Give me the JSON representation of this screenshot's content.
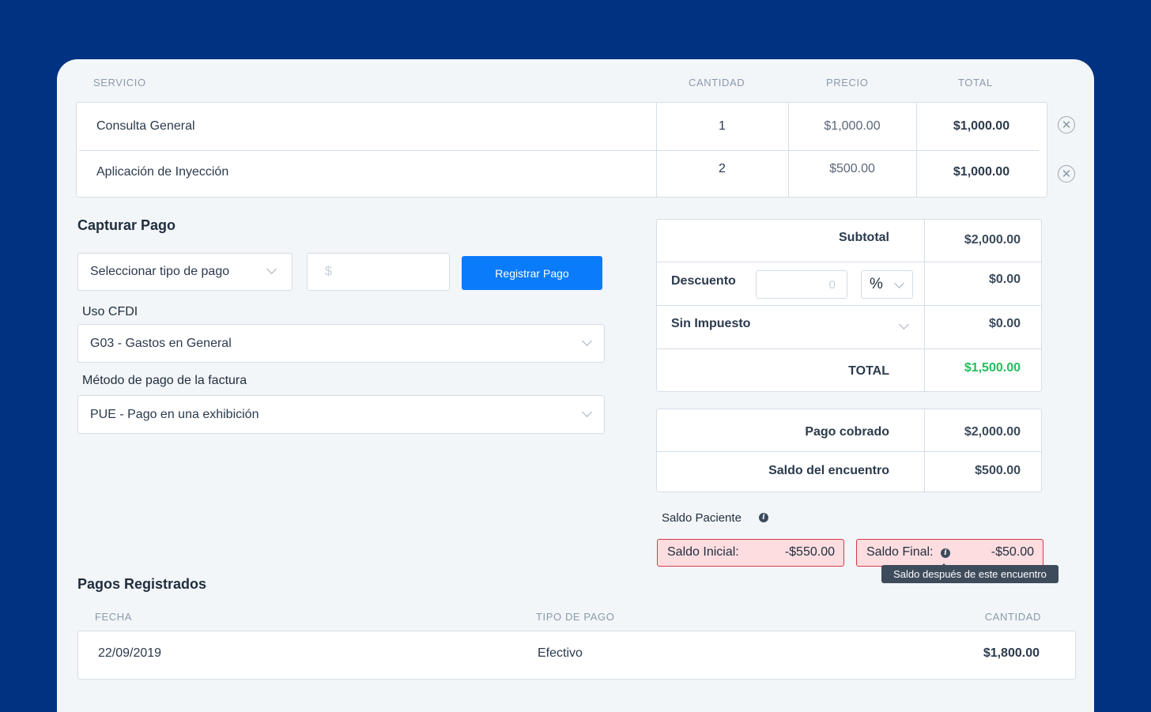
{
  "services": {
    "headers": {
      "service": "SERVICIO",
      "quantity": "CANTIDAD",
      "price": "PRECIO",
      "total": "TOTAL"
    },
    "rows": [
      {
        "service": "Consulta General",
        "quantity": "1",
        "price": "$1,000.00",
        "total": "$1,000.00"
      },
      {
        "service": "Aplicación de Inyección",
        "quantity": "2",
        "price": "$500.00",
        "total": "$1,000.00"
      }
    ],
    "remove_icon": "close-circle-icon"
  },
  "capture": {
    "title": "Capturar Pago",
    "payment_type_placeholder": "Seleccionar tipo de pago",
    "amount_placeholder": "$",
    "register_button": "Registrar Pago",
    "cfdi_label": "Uso CFDI",
    "cfdi_value": "G03 - Gastos en General",
    "method_label": "Método de pago de la factura",
    "method_value": "PUE - Pago en una exhibición"
  },
  "summary": {
    "subtotal_label": "Subtotal",
    "subtotal_value": "$2,000.00",
    "discount_label": "Descuento",
    "discount_input": "0",
    "discount_unit": "%",
    "discount_value": "$0.00",
    "tax_label": "Sin Impuesto",
    "tax_value": "$0.00",
    "total_label": "TOTAL",
    "total_value": "$1,500.00",
    "total_color": "#20c05c"
  },
  "payment": {
    "collected_label": "Pago cobrado",
    "collected_value": "$2,000.00",
    "balance_label": "Saldo del encuentro",
    "balance_value": "$500.00"
  },
  "patient_balance": {
    "title": "Saldo Paciente",
    "initial_label": "Saldo Inicial:",
    "initial_value": "-$550.00",
    "final_label": "Saldo Final:",
    "final_value": "-$50.00",
    "tooltip": "Saldo después de este encuentro",
    "alert_color": "#d7394a"
  },
  "registered": {
    "title": "Pagos Registrados",
    "headers": {
      "date": "FECHA",
      "type": "TIPO DE PAGO",
      "amount": "CANTIDAD"
    },
    "rows": [
      {
        "date": "22/09/2019",
        "type": "Efectivo",
        "amount": "$1,800.00"
      }
    ]
  }
}
